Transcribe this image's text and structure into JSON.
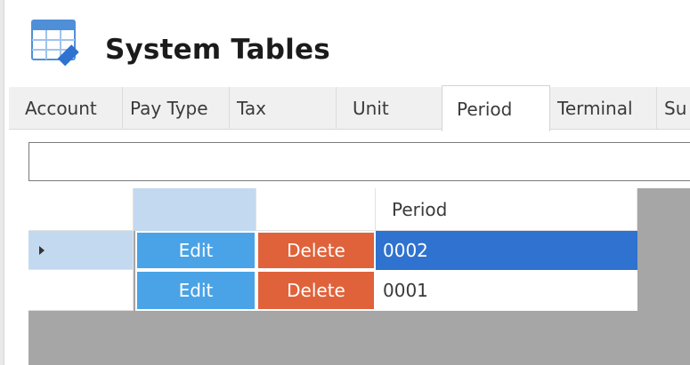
{
  "header": {
    "title": "System Tables",
    "icon": "table-edit-icon"
  },
  "tabs": [
    {
      "label": "Account"
    },
    {
      "label": "Pay Type"
    },
    {
      "label": "Tax"
    },
    {
      "label": "Unit"
    },
    {
      "label": "Period",
      "active": true
    },
    {
      "label": "Terminal"
    },
    {
      "label": "Su"
    }
  ],
  "grid": {
    "columns": [
      "",
      "",
      "",
      "Period"
    ],
    "rows": [
      {
        "edit_label": "Edit",
        "delete_label": "Delete",
        "period": "0002",
        "selected": true
      },
      {
        "edit_label": "Edit",
        "delete_label": "Delete",
        "period": "0001",
        "selected": false
      }
    ]
  },
  "colors": {
    "edit": "#4aa3e6",
    "delete": "#e0623a",
    "selected_row": "#2f72cf",
    "selected_header": "#c3d9ef",
    "grid_empty": "#a6a6a6"
  }
}
